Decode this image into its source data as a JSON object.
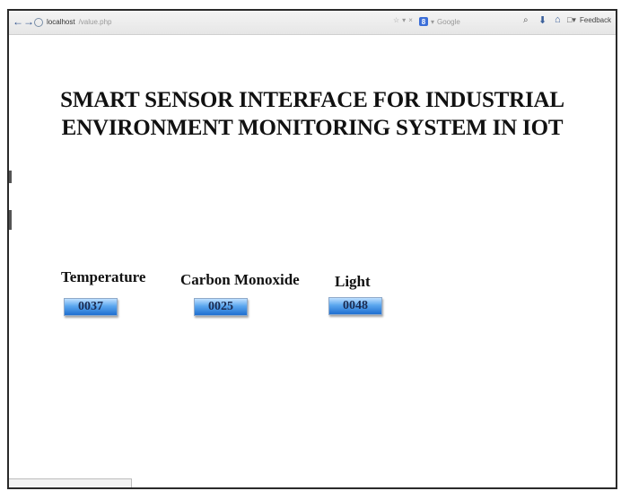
{
  "browser": {
    "url_host": "localhost",
    "url_path": "/value.php",
    "search_placeholder": "Google",
    "feedback_label": "Feedback"
  },
  "page": {
    "title_line1": "SMART SENSOR INTERFACE FOR INDUSTRIAL",
    "title_line2": "ENVIRONMENT MONITORING SYSTEM IN IOT"
  },
  "sensors": [
    {
      "label": "Temperature",
      "value": "0037"
    },
    {
      "label": "Carbon Monoxide",
      "value": "0025"
    },
    {
      "label": "Light",
      "value": "0048"
    }
  ],
  "colors": {
    "value_box_top": "#bfe0ff",
    "value_box_bottom": "#1f6fd0",
    "frame_border": "#2a2a2a"
  }
}
